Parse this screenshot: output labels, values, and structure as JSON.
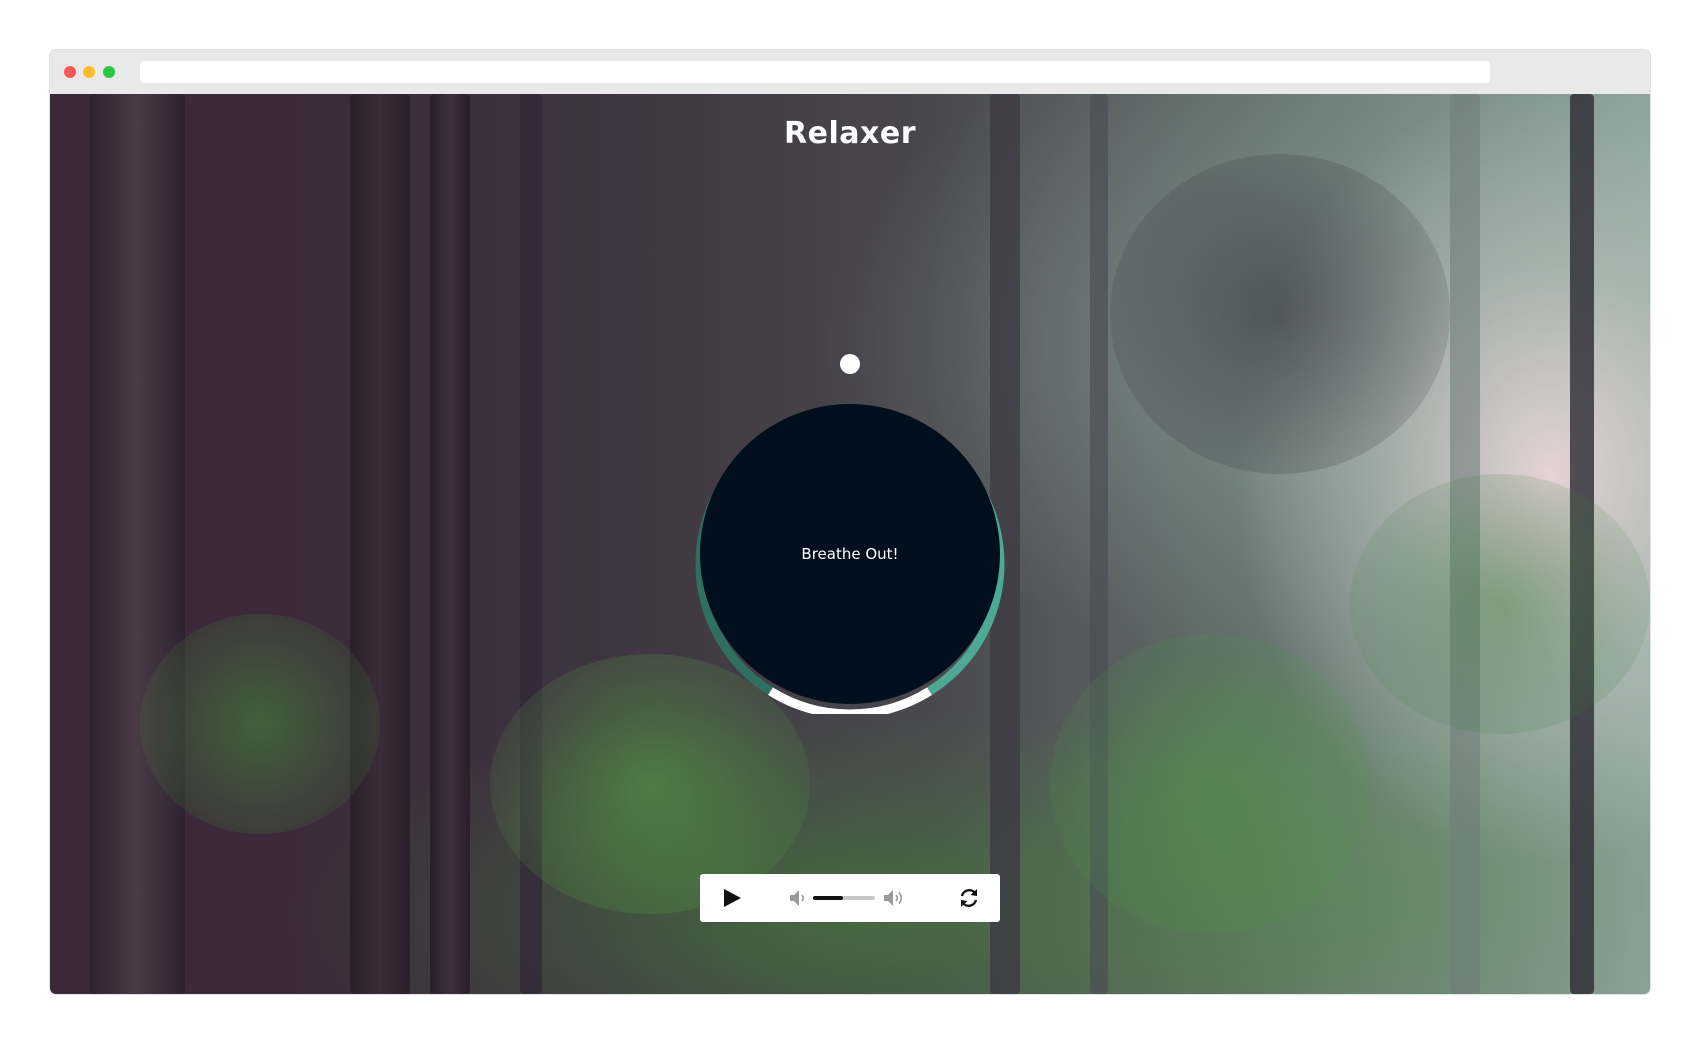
{
  "app": {
    "title": "Relaxer",
    "breath_instruction": "Breathe Out!"
  },
  "colors": {
    "ring_dark": "#2f6f62",
    "ring_light": "#4ea896",
    "ring_white": "#ffffff",
    "circle_fill": "#010f1c"
  },
  "player": {
    "state": "paused",
    "play_icon": "play-icon",
    "volume_low_icon": "volume-low-icon",
    "volume_high_icon": "volume-high-icon",
    "restart_icon": "restart-icon",
    "volume_level": 0.48
  }
}
